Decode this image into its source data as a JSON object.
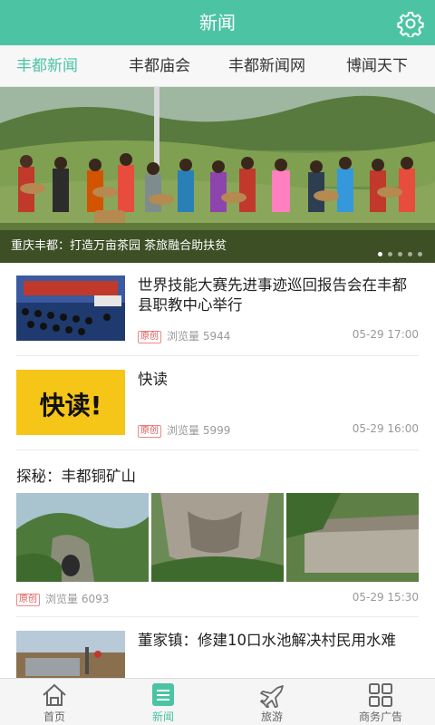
{
  "header": {
    "title": "新闻",
    "settings_icon": "gear-icon"
  },
  "tabs": [
    {
      "label": "丰都新闻",
      "active": true
    },
    {
      "label": "丰都庙会",
      "active": false
    },
    {
      "label": "丰都新闻网",
      "active": false
    },
    {
      "label": "博闻天下",
      "active": false
    }
  ],
  "banner": {
    "caption": "重庆丰都：打造万亩茶园 茶旅融合助扶贫",
    "dots": 5,
    "current": 1
  },
  "feed": [
    {
      "title": "世界技能大赛先进事迹巡回报告会在丰都县职教中心举行",
      "badge": "原创",
      "views": "浏览量 5944",
      "time": "05-29 17:00"
    },
    {
      "title": "快读",
      "badge": "原创",
      "views": "浏览量 5999",
      "time": "05-29 16:00",
      "thumb_text": "快读!"
    },
    {
      "title": "探秘：丰都铜矿山",
      "badge": "原创",
      "views": "浏览量 6093",
      "time": "05-29 15:30"
    },
    {
      "title": "董家镇：修建10口水池解决村民用水难"
    }
  ],
  "bottom_nav": [
    {
      "label": "首页",
      "icon": "home-icon",
      "active": false
    },
    {
      "label": "新闻",
      "icon": "news-list-icon",
      "active": true
    },
    {
      "label": "旅游",
      "icon": "airplane-icon",
      "active": false
    },
    {
      "label": "商务广告",
      "icon": "grid-icon",
      "active": false
    }
  ],
  "colors": {
    "accent": "#4cc4a4",
    "badge": "#dd5555"
  }
}
